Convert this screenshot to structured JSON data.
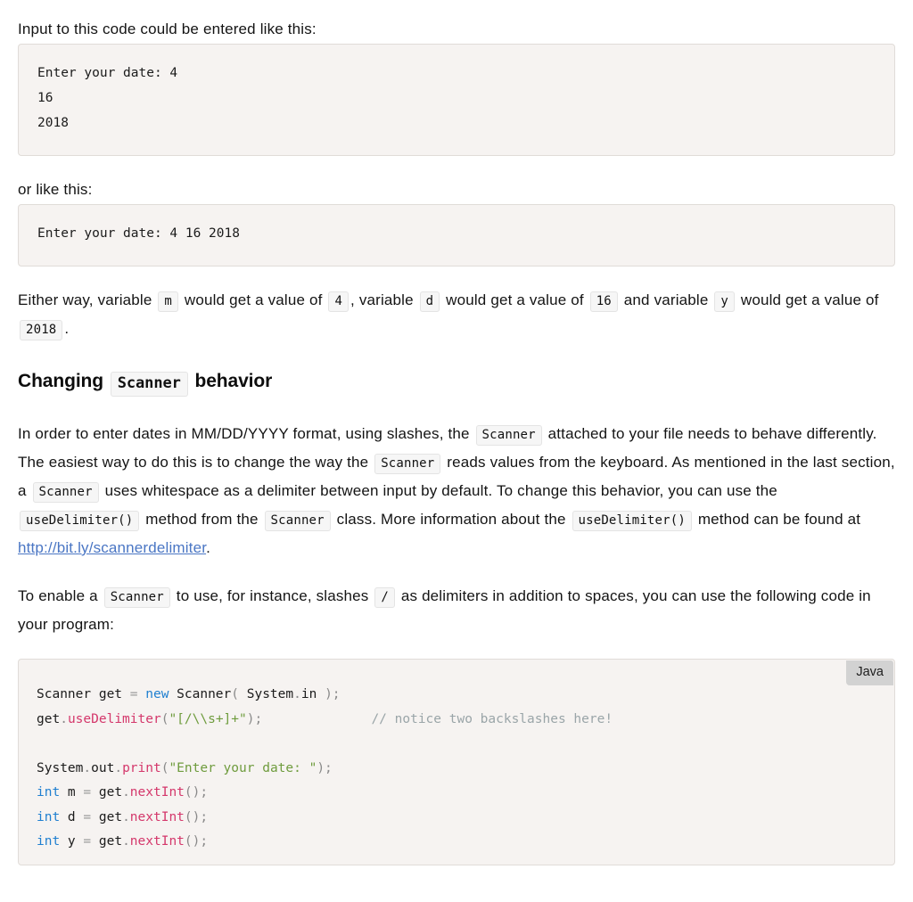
{
  "intro": {
    "paragraph_1": "Input to this code could be entered like this:",
    "paragraph_2": "or like this:"
  },
  "output_block_1": {
    "label": "console-output",
    "lines": [
      "Enter your date: 4",
      "16",
      "2018"
    ],
    "text": "Enter your date: 4\n16\n2018"
  },
  "output_block_2": {
    "label": "console-output",
    "lines": [
      "Enter your date: 4 16 2018"
    ],
    "text": "Enter your date: 4 16 2018"
  },
  "either_way_paragraph": {
    "t1": "Either way, variable",
    "chip_m": "m",
    "t2": "would get a value of",
    "chip_4": "4",
    "t3": ", variable",
    "chip_d": "d",
    "t4": "would get a value of",
    "chip_16": "16",
    "t5": "and variable",
    "chip_y": "y",
    "t6": "would get a value of",
    "chip_2018": "2018",
    "t7": "."
  },
  "heading": {
    "before": "Changing",
    "chip": "Scanner",
    "after": "behavior"
  },
  "scanner_paragraph": {
    "t1": "In order to enter dates in MM/DD/YYYY format, using slashes, the",
    "chip_1": "Scanner",
    "t2": "attached to your file needs to behave differently. The easiest way to do this is to change the way the",
    "chip_2": "Scanner",
    "t3": "reads values from the keyboard. As mentioned in the last section, a",
    "chip_3": "Scanner",
    "t4": "uses whitespace as a delimiter between input by default. To change this behavior, you can use the",
    "chip_4": "useDelimiter()",
    "t5": "method from the",
    "chip_5": "Scanner",
    "t6": "class. More information about the",
    "chip_6": "useDelimiter()",
    "t7": "method can be found at",
    "link_text": "http://bit.ly/scannerdelimiter",
    "link_href": "http://bit.ly/scannerdelimiter",
    "t8": "."
  },
  "enable_paragraph": {
    "t1": "To enable a",
    "chip_1": "Scanner",
    "t2": "to use, for instance, slashes",
    "chip_2": "/",
    "t3": "as delimiters in addition to spaces, you can use the following code in your program:"
  },
  "java_block": {
    "badge": "Java",
    "lines": [
      "Scanner get = new Scanner( System.in );",
      "get.useDelimiter(\"[/\\\\s+]+\");              // notice two backslashes here!",
      "",
      "System.out.print(\"Enter your date: \");",
      "int m = get.nextInt();",
      "int d = get.nextInt();",
      "int y = get.nextInt();"
    ],
    "tokens": {
      "l1_type": "Scanner",
      "l1_var": " get ",
      "l1_eq": "=",
      "l1_new": " new ",
      "l1_ctor": "Scanner",
      "l1_open": "( ",
      "l1_system": "System",
      "l1_dot": ".",
      "l1_in": "in ",
      "l1_close": ");",
      "l2_obj": "get",
      "l2_dot": ".",
      "l2_method": "useDelimiter",
      "l2_open": "(",
      "l2_string": "\"[/\\\\s+]+\"",
      "l2_close": ");",
      "l2_comment": "// notice two backslashes here!",
      "l4_system": "System",
      "l4_dot1": ".",
      "l4_out": "out",
      "l4_dot2": ".",
      "l4_print": "print",
      "l4_open": "(",
      "l4_string": "\"Enter your date: \"",
      "l4_close": ");",
      "l5_kw": "int",
      "l5_var": " m ",
      "l5_eq": "=",
      "l5_obj": " get",
      "l5_dot": ".",
      "l5_method": "nextInt",
      "l5_close": "();",
      "l6_kw": "int",
      "l6_var": " d ",
      "l6_eq": "=",
      "l6_obj": " get",
      "l6_dot": ".",
      "l6_method": "nextInt",
      "l6_close": "();",
      "l7_kw": "int",
      "l7_var": " y ",
      "l7_eq": "=",
      "l7_obj": " get",
      "l7_dot": ".",
      "l7_method": "nextInt",
      "l7_close": "();"
    }
  },
  "colors": {
    "code_block_bg": "#f6f3f1",
    "code_block_border": "#e0dcd8",
    "chip_bg": "#f6f6f6",
    "chip_border": "#e4e4e4",
    "badge_bg": "#d2d2d2",
    "link": "#4a76c4",
    "keyword": "#1f7fd0",
    "method": "#d4376b",
    "string": "#6f9c3e",
    "comment": "#9aa5a8",
    "punctuation": "#8a8a8a",
    "text": "#141414"
  }
}
